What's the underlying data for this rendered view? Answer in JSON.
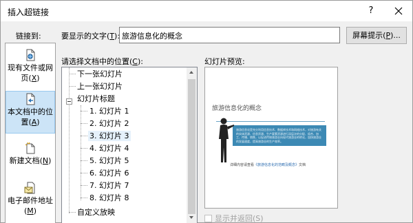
{
  "window": {
    "title": "插入超链接",
    "help": "?"
  },
  "link_to": {
    "label": "链接到:",
    "items": [
      {
        "line1": "现有文件或网",
        "line2": "页",
        "key": "X",
        "icon": "existing-file-icon"
      },
      {
        "line1": "本文档中的位",
        "line2": "置",
        "key": "A",
        "icon": "place-in-document-icon"
      },
      {
        "line1": "新建文档",
        "key": "N",
        "icon": "new-document-icon"
      },
      {
        "line1": "电子邮件地址",
        "key": "M",
        "icon": "email-address-icon"
      }
    ]
  },
  "display_text": {
    "label": "要显示的文字(",
    "key": "T",
    "label_end": "):",
    "value": "旅游信息化的概念"
  },
  "screentip": {
    "label": "屏幕提示(",
    "key": "P",
    "label_end": ")..."
  },
  "place": {
    "label": "请选择文档中的位置(",
    "key": "C",
    "label_end": "):",
    "items": [
      "下一张幻灯片",
      "上一张幻灯片",
      "幻灯片标题",
      "1. 幻灯片 1",
      "2. 幻灯片 2",
      "3. 幻灯片 3",
      "4. 幻灯片 4",
      "5. 幻灯片 5",
      "6. 幻灯片 6",
      "7. 幻灯片 7",
      "8. 幻灯片 8",
      "自定义放映"
    ]
  },
  "preview": {
    "label": "幻灯片预览:",
    "slide_title": "旅游信息化的概念",
    "slide_body": "旅游信息化是充分利用信息技术、数据库技术和网络技术，对旅游有关的实体资源、信息资源、生产要素资源进行深层次的分配、组合、加工、传播、销售，以促进传统旅游业向现代旅游业的转化，加快旅游业的发展速度，提高旅游业的生产效率。",
    "footer_prefix": "详细内容请查看",
    "footer_link": "《旅游信息化的范畴及概念》",
    "footer_suffix": "文档"
  },
  "show_and_return": {
    "label": "显示并返回(S)",
    "checked": false
  }
}
